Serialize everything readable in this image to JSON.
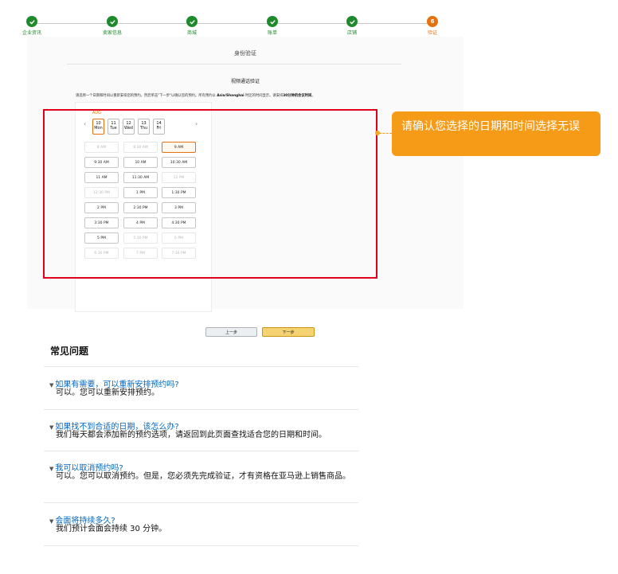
{
  "stepper": {
    "steps": [
      {
        "label": "企业资讯",
        "state": "done"
      },
      {
        "label": "卖家信息",
        "state": "done"
      },
      {
        "label": "商城",
        "state": "done"
      },
      {
        "label": "账单",
        "state": "done"
      },
      {
        "label": "店铺",
        "state": "done"
      },
      {
        "label": "验证",
        "state": "active",
        "number": "6"
      }
    ]
  },
  "panel": {
    "title": "身份验证",
    "subtitle": "视频通话验证",
    "instruction_pre": "请选择一个日期和时间以重新安排您的预约。然后单击\"下一步\"以确认您的预约。所有预约以 ",
    "instruction_tz": "Asia/Shanghai",
    "instruction_mid": " 时区的时间显示。请安排",
    "instruction_bold": "30分钟的会议时间",
    "instruction_end": "。"
  },
  "calendar": {
    "month": "AUG",
    "prev_icon": "‹",
    "next_icon": "›",
    "days": [
      {
        "num": "10",
        "dow": "Mon",
        "selected": true
      },
      {
        "num": "11",
        "dow": "Tue",
        "selected": false
      },
      {
        "num": "12",
        "dow": "Wed",
        "selected": false
      },
      {
        "num": "13",
        "dow": "Thu",
        "selected": false
      },
      {
        "num": "14",
        "dow": "Fri",
        "selected": false
      }
    ],
    "slots": [
      {
        "label": "8 AM",
        "state": "disabled"
      },
      {
        "label": "8:30 AM",
        "state": "disabled"
      },
      {
        "label": "9 AM",
        "state": "selected"
      },
      {
        "label": "9:30 AM",
        "state": "available"
      },
      {
        "label": "10 AM",
        "state": "available"
      },
      {
        "label": "10:30 AM",
        "state": "available"
      },
      {
        "label": "11 AM",
        "state": "available"
      },
      {
        "label": "11:30 AM",
        "state": "available"
      },
      {
        "label": "12 PM",
        "state": "disabled"
      },
      {
        "label": "12:30 PM",
        "state": "disabled"
      },
      {
        "label": "1 PM",
        "state": "available"
      },
      {
        "label": "1:30 PM",
        "state": "available"
      },
      {
        "label": "2 PM",
        "state": "available"
      },
      {
        "label": "2:30 PM",
        "state": "available"
      },
      {
        "label": "3 PM",
        "state": "available"
      },
      {
        "label": "3:30 PM",
        "state": "available"
      },
      {
        "label": "4 PM",
        "state": "available"
      },
      {
        "label": "4:30 PM",
        "state": "available"
      },
      {
        "label": "5 PM",
        "state": "available"
      },
      {
        "label": "5:30 PM",
        "state": "disabled"
      },
      {
        "label": "6 PM",
        "state": "disabled"
      },
      {
        "label": "6:30 PM",
        "state": "disabled"
      },
      {
        "label": "7 PM",
        "state": "disabled"
      },
      {
        "label": "7:30 PM",
        "state": "disabled"
      }
    ]
  },
  "callout": {
    "text": "请确认您选择的日期和时间选择无误"
  },
  "buttons": {
    "prev": "上一步",
    "next": "下一步"
  },
  "faq": {
    "title": "常见问题",
    "items": [
      {
        "q": "如果有需要，可以重新安排预约吗?",
        "a": "可以。您可以重新安排预约。"
      },
      {
        "q": "如果找不到合适的日期，该怎么办?",
        "a": "我们每天都会添加新的预约选项，请返回到此页面查找适合您的日期和时间。"
      },
      {
        "q": "我可以取消预约吗?",
        "a": "可以。您可以取消预约。但是，您必须先完成验证，才有资格在亚马逊上销售商品。"
      },
      {
        "q": "会面将持续多久?",
        "a": "我们预计会面会持续 30 分钟。"
      }
    ]
  },
  "colors": {
    "done": "#1e8a2c",
    "active": "#e5720e",
    "highlight_box": "#e0001a",
    "callout_bg": "#f59b18",
    "link": "#0066c0"
  }
}
